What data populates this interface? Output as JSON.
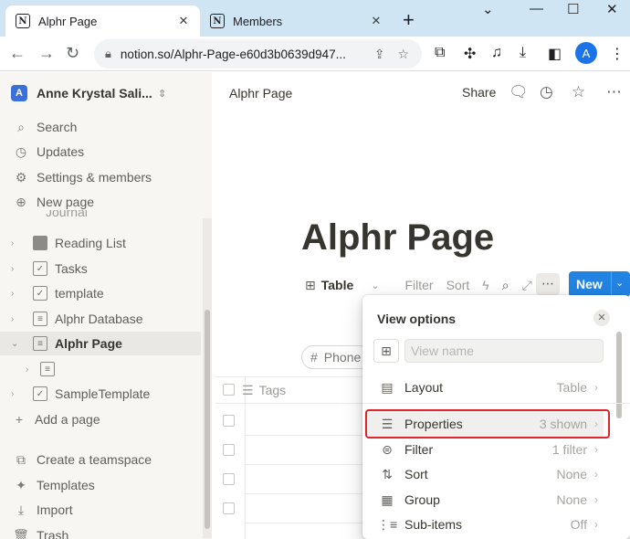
{
  "browser": {
    "tabs": [
      {
        "title": "Alphr Page",
        "favicon": "N",
        "active": true
      },
      {
        "title": "Members",
        "favicon": "N",
        "active": false
      }
    ],
    "url": "notion.so/Alphr-Page-e60d3b0639d947...",
    "avatar_letter": "A"
  },
  "sidebar": {
    "workspace": {
      "badge": "A",
      "name": "Anne Krystal Sali..."
    },
    "menu": [
      {
        "label": "Search",
        "icon": "search-icon"
      },
      {
        "label": "Updates",
        "icon": "clock-icon"
      },
      {
        "label": "Settings & members",
        "icon": "gear-icon"
      },
      {
        "label": "New page",
        "icon": "plus-circle-icon"
      }
    ],
    "cut_item": "Journal",
    "pages": [
      {
        "label": "Reading List",
        "icon": "book-icon"
      },
      {
        "label": "Tasks",
        "icon": "checkbox-icon"
      },
      {
        "label": "template",
        "icon": "checkbox-icon"
      },
      {
        "label": "Alphr Database",
        "icon": "page-icon"
      },
      {
        "label": "Alphr Page",
        "icon": "page-icon",
        "selected": true
      },
      {
        "label": "",
        "icon": "page-icon"
      },
      {
        "label": "SampleTemplate",
        "icon": "checkbox-icon"
      }
    ],
    "add_page": "Add a page",
    "bottom": [
      {
        "label": "Create a teamspace",
        "icon": "teamspace-icon"
      },
      {
        "label": "Templates",
        "icon": "templates-icon"
      },
      {
        "label": "Import",
        "icon": "import-icon"
      },
      {
        "label": "Trash",
        "icon": "trash-icon"
      }
    ]
  },
  "topbar": {
    "breadcrumb": "Alphr Page",
    "share": "Share"
  },
  "page": {
    "title": "Alphr Page",
    "db_toolbar": {
      "view": "Table",
      "filter": "Filter",
      "sort": "Sort",
      "new": "New"
    },
    "filter_chip": "Phone",
    "column": "Tags"
  },
  "view_options": {
    "title": "View options",
    "view_name_placeholder": "View name",
    "rows": [
      {
        "label": "Layout",
        "value": "Table",
        "icon": "layout-icon"
      },
      {
        "label": "Properties",
        "value": "3 shown",
        "icon": "list-icon",
        "highlighted": true
      },
      {
        "label": "Filter",
        "value": "1 filter",
        "icon": "filter-icon"
      },
      {
        "label": "Sort",
        "value": "None",
        "icon": "sort-icon"
      },
      {
        "label": "Group",
        "value": "None",
        "icon": "group-icon"
      },
      {
        "label": "Sub-items",
        "value": "Off",
        "icon": "subitems-icon"
      }
    ]
  },
  "colors": {
    "accent": "#2383e2",
    "highlight_border": "#e0252b",
    "sidebar_bg": "#f7f6f3",
    "tabbar_bg": "#cfe5f3"
  }
}
